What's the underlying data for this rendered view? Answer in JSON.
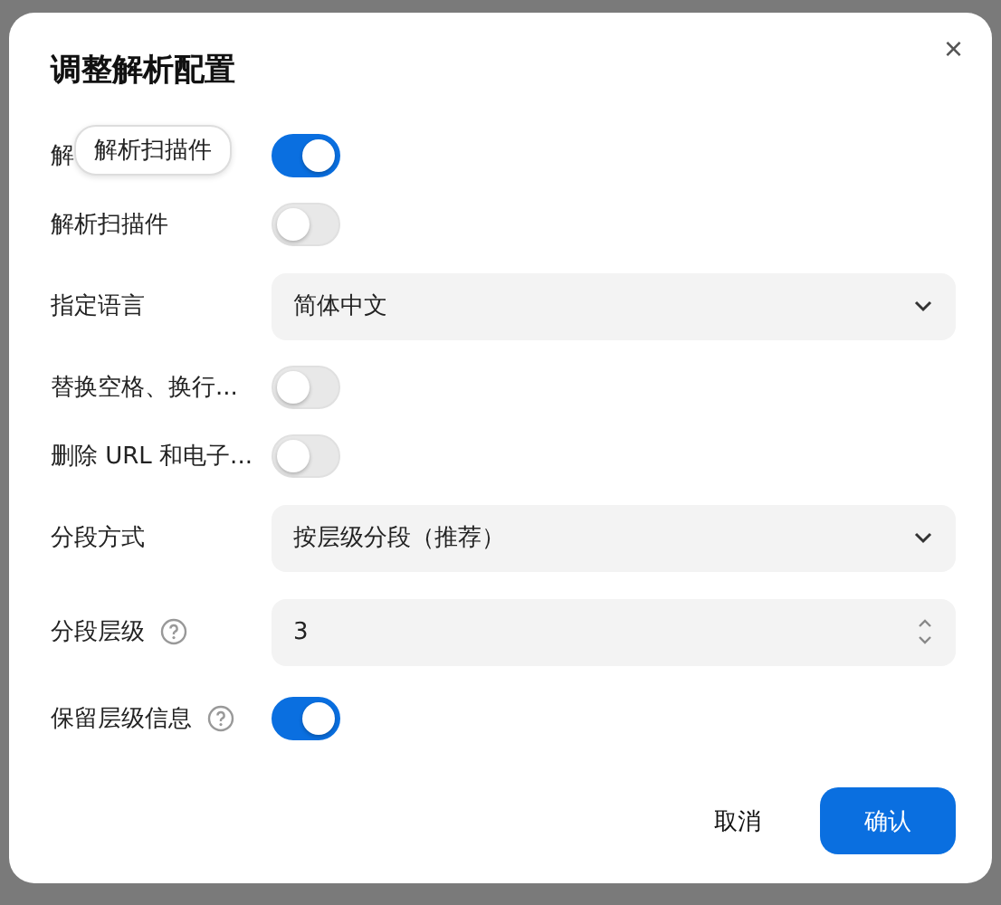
{
  "dialog": {
    "title": "调整解析配置",
    "close_icon": "×"
  },
  "tooltip": {
    "text": "解析扫描件"
  },
  "settings": [
    {
      "kind": "switch",
      "label": "解",
      "on": true
    },
    {
      "kind": "switch",
      "label": "解析扫描件",
      "on": false
    },
    {
      "kind": "select",
      "label": "指定语言",
      "value": "简体中文"
    },
    {
      "kind": "switch",
      "label": "替换空格、换行...",
      "on": false
    },
    {
      "kind": "switch",
      "label": "删除 URL 和电子...",
      "on": false
    },
    {
      "kind": "select",
      "label": "分段方式",
      "value": "按层级分段（推荐）"
    },
    {
      "kind": "number",
      "label": "分段层级",
      "help": true,
      "value": "3"
    },
    {
      "kind": "switch",
      "label": "保留层级信息",
      "help": true,
      "on": true
    }
  ],
  "buttons": [
    {
      "kind": "secondary",
      "label": "取消"
    },
    {
      "kind": "primary",
      "label": "确认"
    }
  ]
}
